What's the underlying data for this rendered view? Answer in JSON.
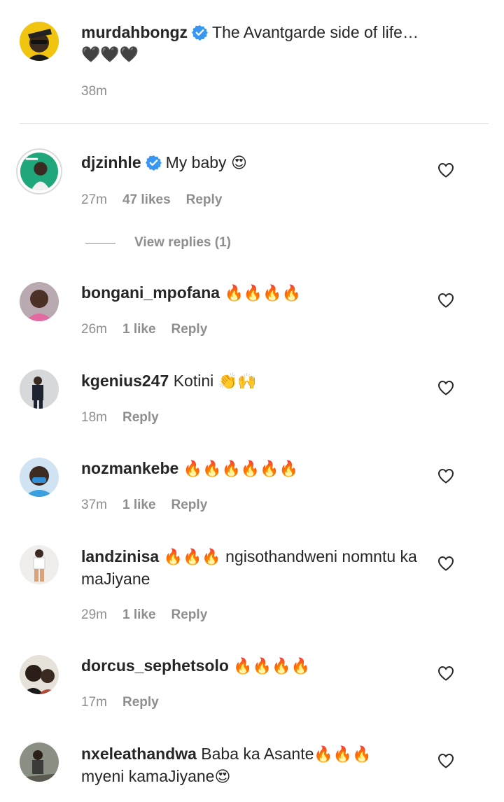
{
  "caption": {
    "username": "murdahbongz",
    "text": "The Avantgarde side of life…",
    "emojis": "🖤🖤🖤",
    "time": "38m"
  },
  "comments": [
    {
      "username": "djzinhle",
      "text": "My baby",
      "emoji": "😍",
      "time": "27m",
      "likes": "47 likes",
      "reply": "Reply",
      "view_replies": "View replies (1)"
    },
    {
      "username": "bongani_mpofana",
      "emoji": "🔥🔥🔥🔥",
      "time": "26m",
      "likes": "1 like",
      "reply": "Reply"
    },
    {
      "username": "kgenius247",
      "text": "Kotini",
      "emoji": "👏🙌",
      "time": "18m",
      "reply": "Reply"
    },
    {
      "username": "nozmankebe",
      "emoji": "🔥🔥🔥🔥🔥🔥",
      "time": "37m",
      "likes": "1 like",
      "reply": "Reply"
    },
    {
      "username": "landzinisa",
      "emoji": "🔥🔥🔥",
      "text": "ngisothandweni nomntu ka maJiyane",
      "time": "29m",
      "likes": "1 like",
      "reply": "Reply"
    },
    {
      "username": "dorcus_sephetsolo",
      "emoji": "🔥🔥🔥🔥",
      "time": "17m",
      "reply": "Reply"
    },
    {
      "username": "nxeleathandwa",
      "text": "Baba ka Asante",
      "emoji": "🔥🔥🔥",
      "text2": "myeni kamaJiyane",
      "emoji2": "😍"
    }
  ],
  "icons": {
    "verified": "verified-badge-icon",
    "like": "heart-outline-icon"
  },
  "colors": {
    "verified": "#3897f0",
    "meta_text": "#8e8e8e",
    "primary_text": "#262626"
  }
}
